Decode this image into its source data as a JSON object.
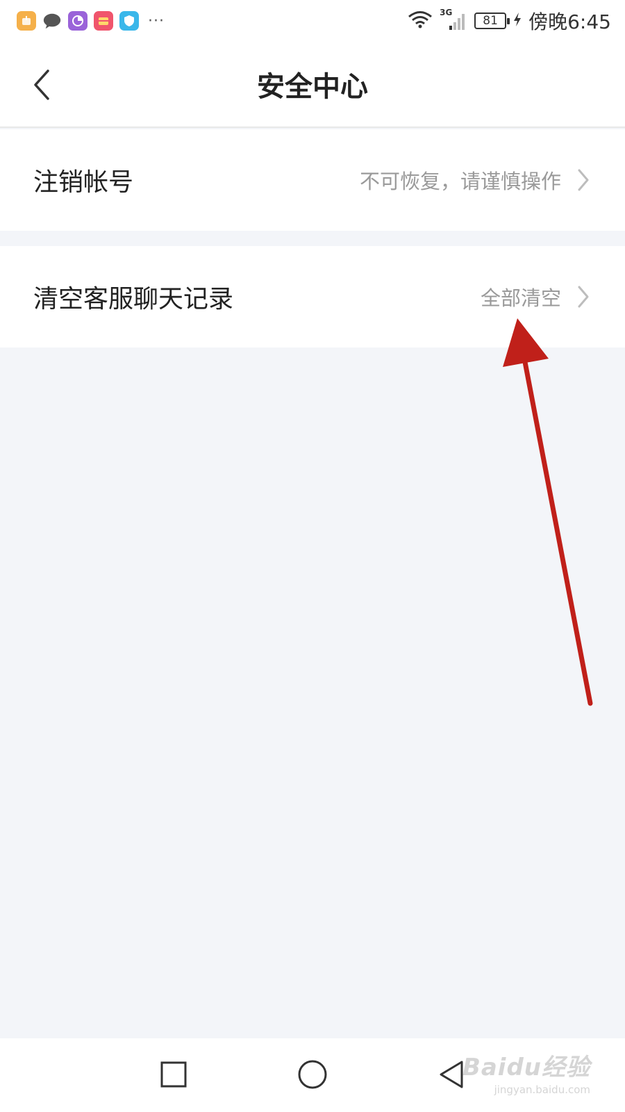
{
  "status_bar": {
    "notification_icons": [
      "package-icon",
      "chat-icon",
      "pie-chart-icon",
      "wallet-icon",
      "shield-icon"
    ],
    "more": "···",
    "network": "3G",
    "battery": "81",
    "time": "傍晚6:45"
  },
  "header": {
    "title": "安全中心"
  },
  "settings": [
    {
      "label": "注销帐号",
      "hint": "不可恢复，请谨慎操作"
    },
    {
      "label": "清空客服聊天记录",
      "hint": "全部清空"
    }
  ],
  "system_nav": {
    "buttons": [
      "recents",
      "home",
      "back"
    ]
  },
  "watermark": {
    "text": "Baidu经验",
    "url": "jingyan.baidu.com"
  },
  "annotation": {
    "color": "#c0201a"
  }
}
